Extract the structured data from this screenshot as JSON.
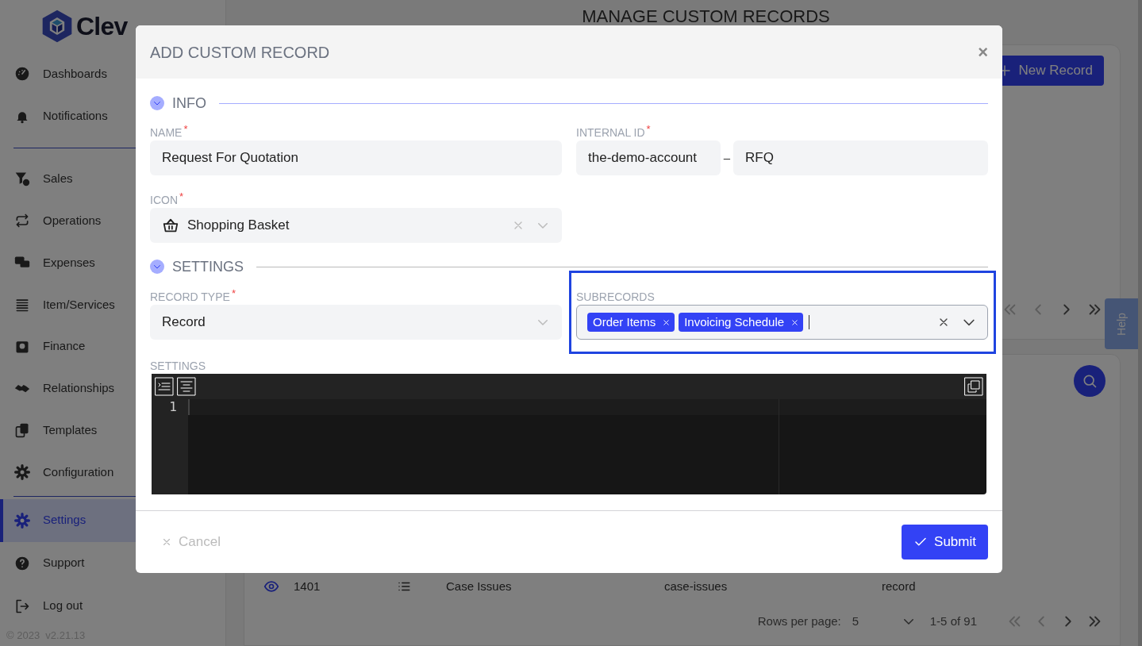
{
  "sidebar": {
    "logo": "Clev",
    "groups": [
      [
        {
          "label": "Dashboards",
          "selected": false
        },
        {
          "label": "Notifications",
          "selected": false
        }
      ],
      [
        {
          "label": "Sales",
          "selected": false
        },
        {
          "label": "Operations",
          "selected": false
        },
        {
          "label": "Expenses",
          "selected": false
        },
        {
          "label": "Item/Services",
          "selected": false
        },
        {
          "label": "Finance",
          "selected": false
        },
        {
          "label": "Relationships",
          "selected": false
        },
        {
          "label": "Templates",
          "selected": false
        },
        {
          "label": "Configuration",
          "selected": false
        }
      ],
      [
        {
          "label": "Settings",
          "selected": true
        },
        {
          "label": "Support",
          "selected": false
        },
        {
          "label": "Log out",
          "selected": false
        }
      ]
    ],
    "footer": "© 2023  v2.21.13"
  },
  "page": {
    "title": "MANAGE CUSTOM RECORDS",
    "new_button": "New Record",
    "help_tab": "Help",
    "table_row": {
      "id": "1401",
      "name": "Case Issues",
      "internal_id": "case-issues",
      "type": "record"
    },
    "pagination": {
      "rows_per_page_label": "Rows per page:",
      "rows_per_page": "5",
      "range": "1-5 of 91"
    }
  },
  "dialog": {
    "title": "ADD CUSTOM RECORD",
    "close": "×",
    "sections": [
      {
        "title": "INFO",
        "expanded": true,
        "kind": "info"
      },
      {
        "title": "SETTINGS",
        "expanded": true,
        "kind": "settings"
      }
    ],
    "name": {
      "label": "NAME",
      "required": true,
      "value": "Request For Quotation"
    },
    "internal_id": {
      "label": "INTERNAL ID",
      "required": true,
      "prefix": "the-demo-account",
      "separator": "–",
      "value": "RFQ"
    },
    "icon": {
      "label": "ICON",
      "required": true,
      "value": "Shopping Basket"
    },
    "record_type": {
      "label": "RECORD TYPE",
      "required": true,
      "value": "Record"
    },
    "subrecords": {
      "label": "SUBRECORDS",
      "highlighted": true,
      "values": [
        "Order Items",
        "Invoicing Schedule"
      ]
    },
    "settings_editor": {
      "label": "SETTINGS",
      "line_numbers": [
        "1"
      ]
    },
    "required_mark": "*",
    "cancel": "Cancel",
    "submit": "Submit"
  }
}
